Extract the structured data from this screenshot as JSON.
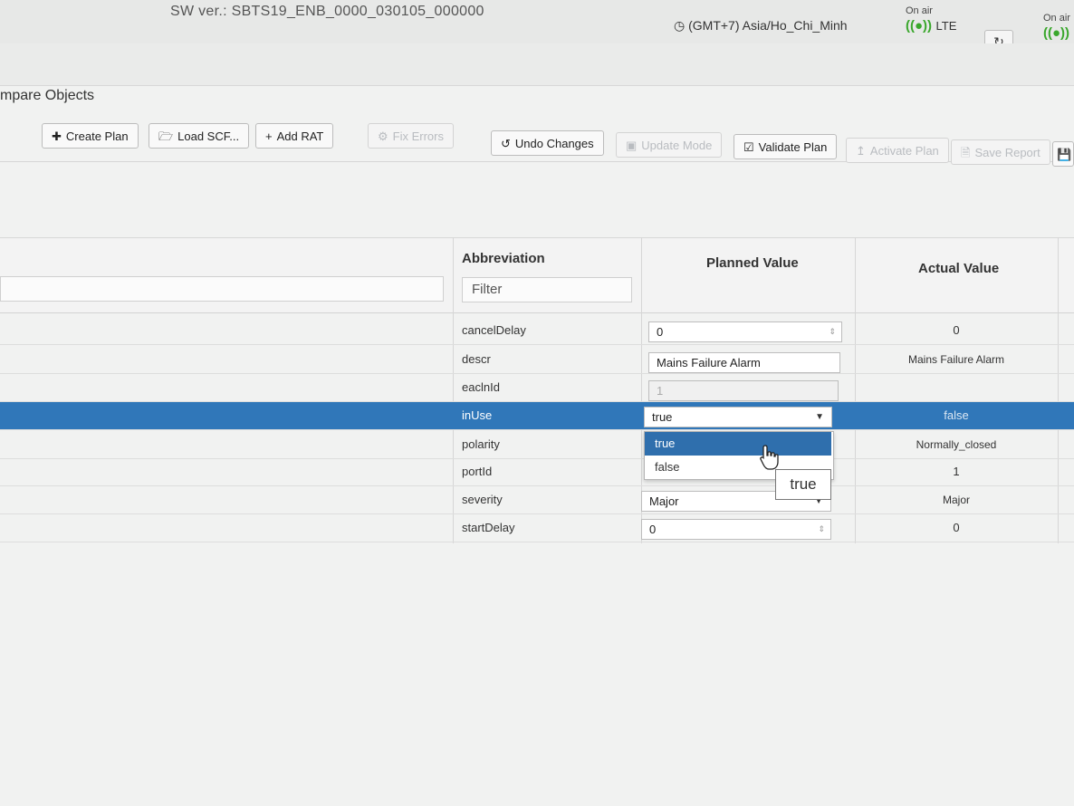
{
  "header": {
    "sw_version": "SW ver.: SBTS19_ENB_0000_030105_000000",
    "timezone": "(GMT+7) Asia/Ho_Chi_Minh",
    "status1": {
      "label": "On air",
      "rat": "LTE"
    },
    "status2": {
      "label": "On air"
    }
  },
  "section_title": "mpare Objects",
  "toolbar": {
    "create_plan": "Create Plan",
    "load_scf": "Load SCF...",
    "add_rat": "Add RAT",
    "fix_errors": "Fix Errors",
    "undo_changes": "Undo Changes",
    "update_mode": "Update Mode",
    "validate_plan": "Validate Plan",
    "activate_plan": "Activate Plan",
    "save_report": "Save Report"
  },
  "table": {
    "headers": {
      "abbreviation": "Abbreviation",
      "planned_value": "Planned Value",
      "actual_value": "Actual Value"
    },
    "filter_placeholder": "Filter",
    "rows": [
      {
        "abbr": "cancelDelay",
        "planned": "0",
        "actual": "0"
      },
      {
        "abbr": "descr",
        "planned": "Mains Failure Alarm",
        "actual": "Mains Failure Alarm"
      },
      {
        "abbr": "eaclnId",
        "planned": "1",
        "actual": ""
      },
      {
        "abbr": "inUse",
        "planned": "true",
        "actual": "false"
      },
      {
        "abbr": "polarity",
        "planned": "",
        "actual": "Normally_closed"
      },
      {
        "abbr": "portId",
        "planned": "",
        "actual": "1"
      },
      {
        "abbr": "severity",
        "planned": "Major",
        "actual": "Major"
      },
      {
        "abbr": "startDelay",
        "planned": "0",
        "actual": "0"
      }
    ]
  },
  "dropdown": {
    "options": [
      "true",
      "false"
    ],
    "highlighted": "true",
    "tooltip": "true"
  },
  "colors": {
    "selected_row": "#3077b9",
    "onair_green": "#3aa72c"
  }
}
